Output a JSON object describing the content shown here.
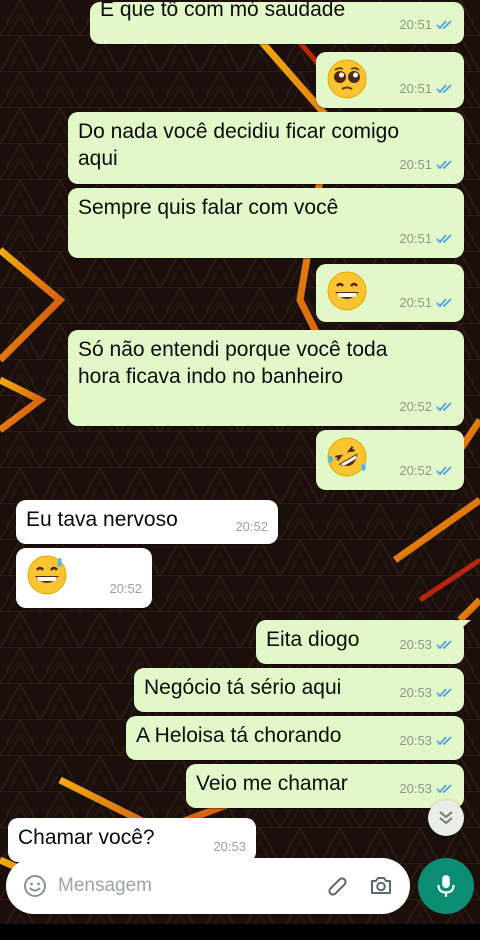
{
  "chat": {
    "messages": [
      {
        "id": "m1",
        "direction": "out",
        "text": "E que tô com mó saudade",
        "time": "20:51",
        "status": "read"
      },
      {
        "id": "m2",
        "direction": "out",
        "emoji": "pleading-face",
        "time": "20:51",
        "status": "read"
      },
      {
        "id": "m3",
        "direction": "out",
        "text_lines": [
          "Do nada você decidiu ficar comigo",
          "aqui"
        ],
        "time": "20:51",
        "status": "read"
      },
      {
        "id": "m4",
        "direction": "out",
        "text": "Sempre quis falar com você",
        "time": "20:51",
        "status": "read"
      },
      {
        "id": "m5",
        "direction": "out",
        "emoji": "grinning-face",
        "time": "20:51",
        "status": "read"
      },
      {
        "id": "m6",
        "direction": "out",
        "text_lines": [
          "Só não entendi porque você toda",
          "hora ficava indo no banheiro"
        ],
        "time": "20:52",
        "status": "read"
      },
      {
        "id": "m7",
        "direction": "out",
        "emoji": "rolling-on-floor-laughing",
        "time": "20:52",
        "status": "read"
      },
      {
        "id": "m8",
        "direction": "in",
        "text": "Eu tava nervoso",
        "time": "20:52"
      },
      {
        "id": "m9",
        "direction": "in",
        "emoji": "grinning-face-with-sweat",
        "time": "20:52"
      },
      {
        "id": "m10",
        "direction": "out",
        "text": "Eita diogo",
        "time": "20:53",
        "status": "read"
      },
      {
        "id": "m11",
        "direction": "out",
        "text": "Negócio tá sério aqui",
        "time": "20:53",
        "status": "read"
      },
      {
        "id": "m12",
        "direction": "out",
        "text": "A Heloisa tá chorando",
        "time": "20:53",
        "status": "read"
      },
      {
        "id": "m13",
        "direction": "out",
        "text": "Veio me chamar",
        "time": "20:53",
        "status": "read"
      },
      {
        "id": "m14",
        "direction": "in",
        "text": "Chamar você?",
        "time": "20:53"
      }
    ]
  },
  "composer": {
    "placeholder": "Mensagem",
    "icons": [
      "emoji-icon",
      "attach-icon",
      "camera-icon"
    ],
    "mic_icon": "microphone-icon"
  },
  "scroll_down_icon": "double-chevron-down-icon",
  "colors": {
    "outgoing_bubble": "#e3f8c8",
    "incoming_bubble": "#ffffff",
    "read_ticks": "#4fa3e0",
    "mic_button": "#0a8d72",
    "wallpaper_lines": "#f4a40a"
  }
}
